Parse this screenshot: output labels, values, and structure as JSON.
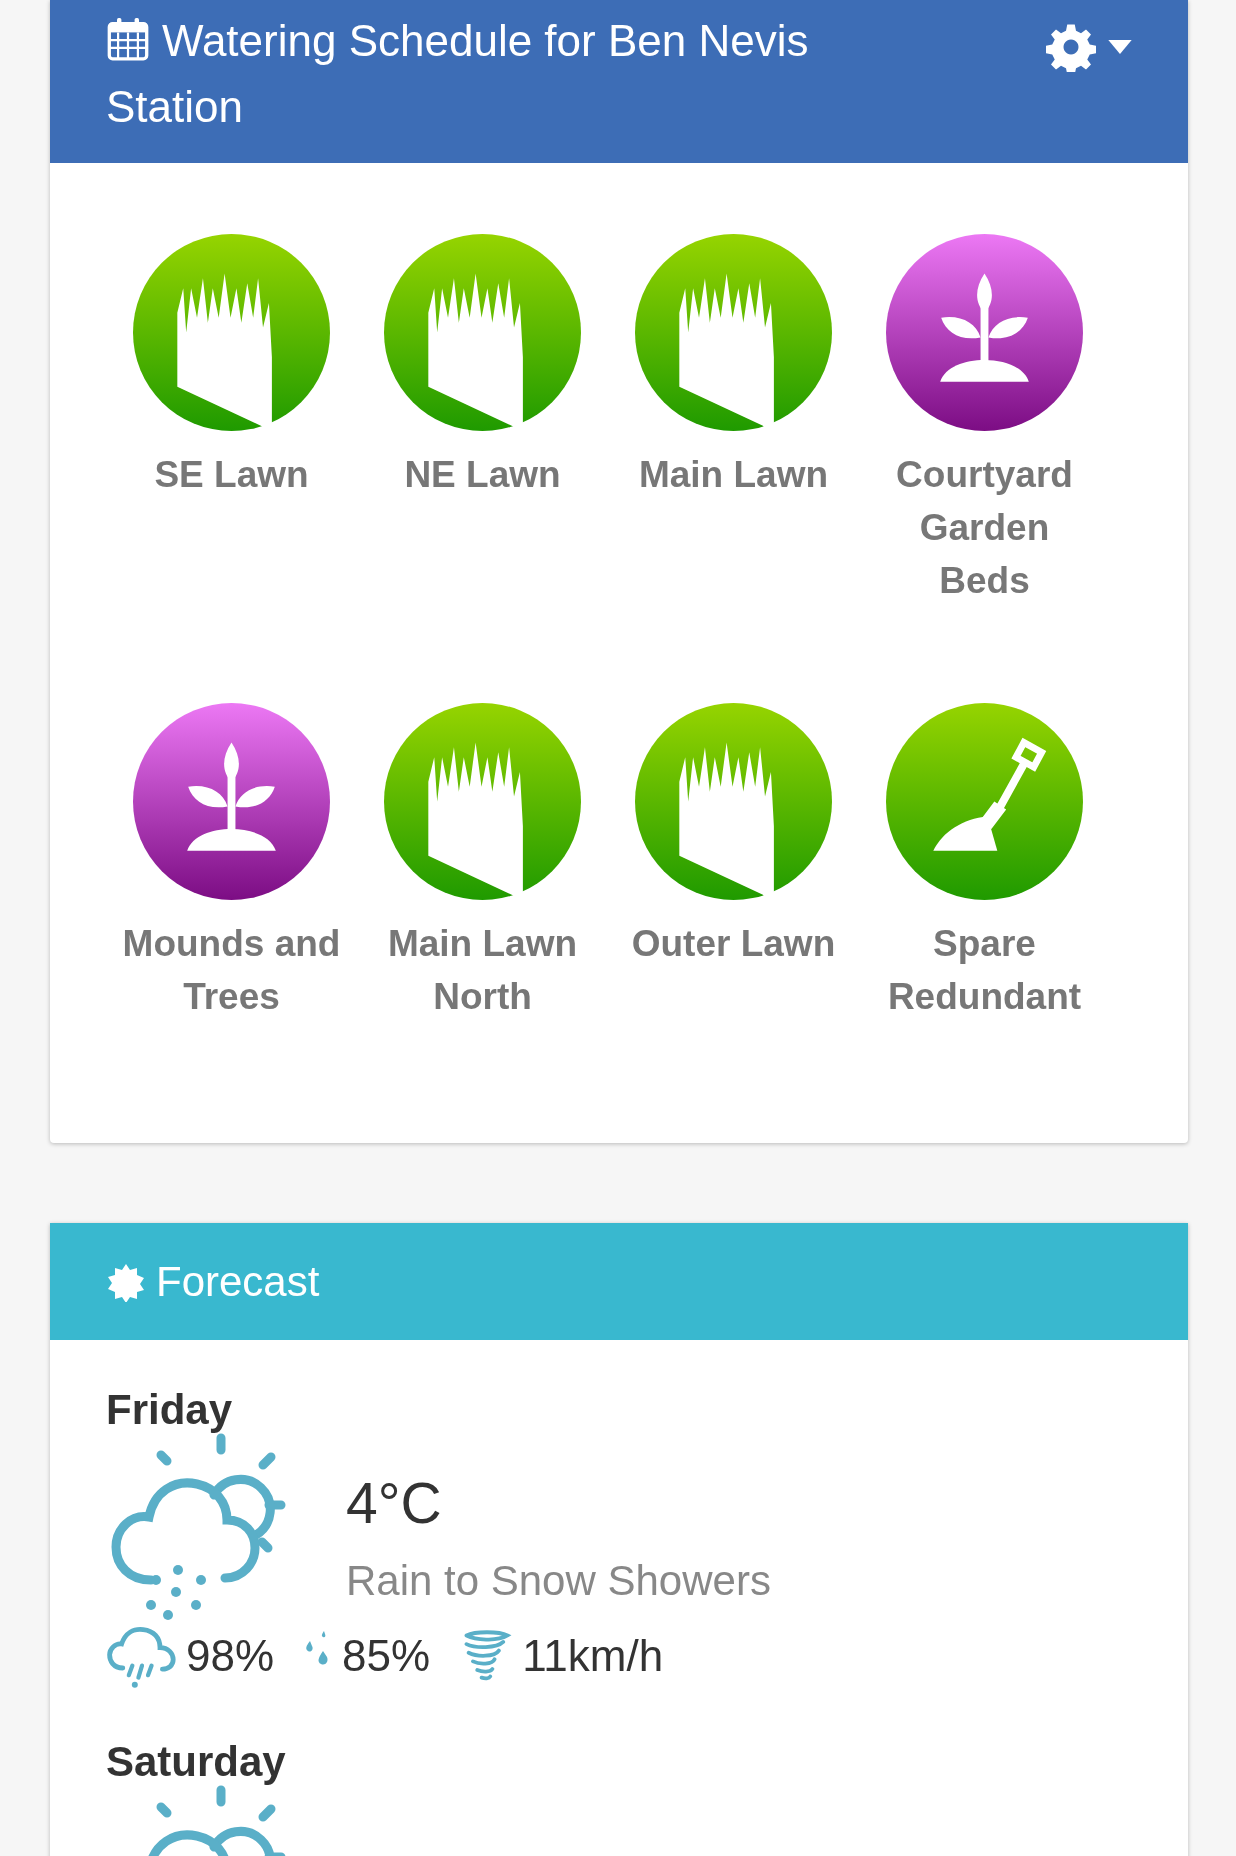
{
  "schedule": {
    "title": "Watering Schedule for Ben Nevis Station"
  },
  "zones": [
    {
      "name": "SE Lawn",
      "kind": "lawn"
    },
    {
      "name": "NE Lawn",
      "kind": "lawn"
    },
    {
      "name": "Main Lawn",
      "kind": "lawn"
    },
    {
      "name": "Courtyard Garden Beds",
      "kind": "plant"
    },
    {
      "name": "Mounds and Trees",
      "kind": "plant"
    },
    {
      "name": "Main Lawn North",
      "kind": "lawn"
    },
    {
      "name": "Outer Lawn",
      "kind": "lawn"
    },
    {
      "name": "Spare Redundant",
      "kind": "spade"
    }
  ],
  "forecast": {
    "title": "Forecast",
    "days": [
      {
        "day": "Friday",
        "temperature": "4°C",
        "summary": "Rain to Snow Showers",
        "precipitation": "98%",
        "humidity": "85%",
        "wind": "11km/h"
      },
      {
        "day": "Saturday"
      }
    ]
  }
}
